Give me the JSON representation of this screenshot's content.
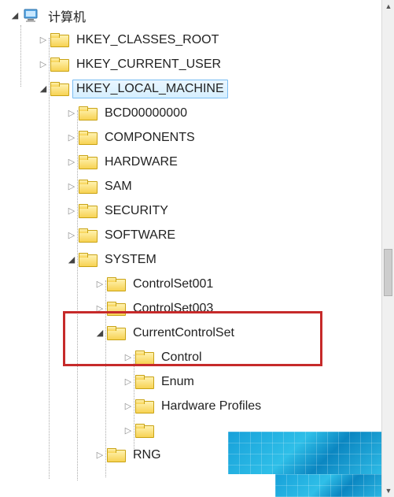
{
  "root": {
    "label": "计算机"
  },
  "hives": [
    {
      "label": "HKEY_CLASSES_ROOT",
      "expanded": false
    },
    {
      "label": "HKEY_CURRENT_USER",
      "expanded": false
    },
    {
      "label": "HKEY_LOCAL_MACHINE",
      "expanded": true,
      "selected": true
    }
  ],
  "hklm": [
    {
      "label": "BCD00000000"
    },
    {
      "label": "COMPONENTS"
    },
    {
      "label": "HARDWARE"
    },
    {
      "label": "SAM"
    },
    {
      "label": "SECURITY"
    },
    {
      "label": "SOFTWARE"
    },
    {
      "label": "SYSTEM",
      "expanded": true
    }
  ],
  "system": [
    {
      "label": "ControlSet001"
    },
    {
      "label": "ControlSet003"
    },
    {
      "label": "CurrentControlSet",
      "expanded": true
    },
    {
      "label": "RNG"
    }
  ],
  "ccs": [
    {
      "label": "Control"
    },
    {
      "label": "Enum"
    },
    {
      "label": "Hardware Profiles"
    },
    {
      "label": ""
    }
  ]
}
